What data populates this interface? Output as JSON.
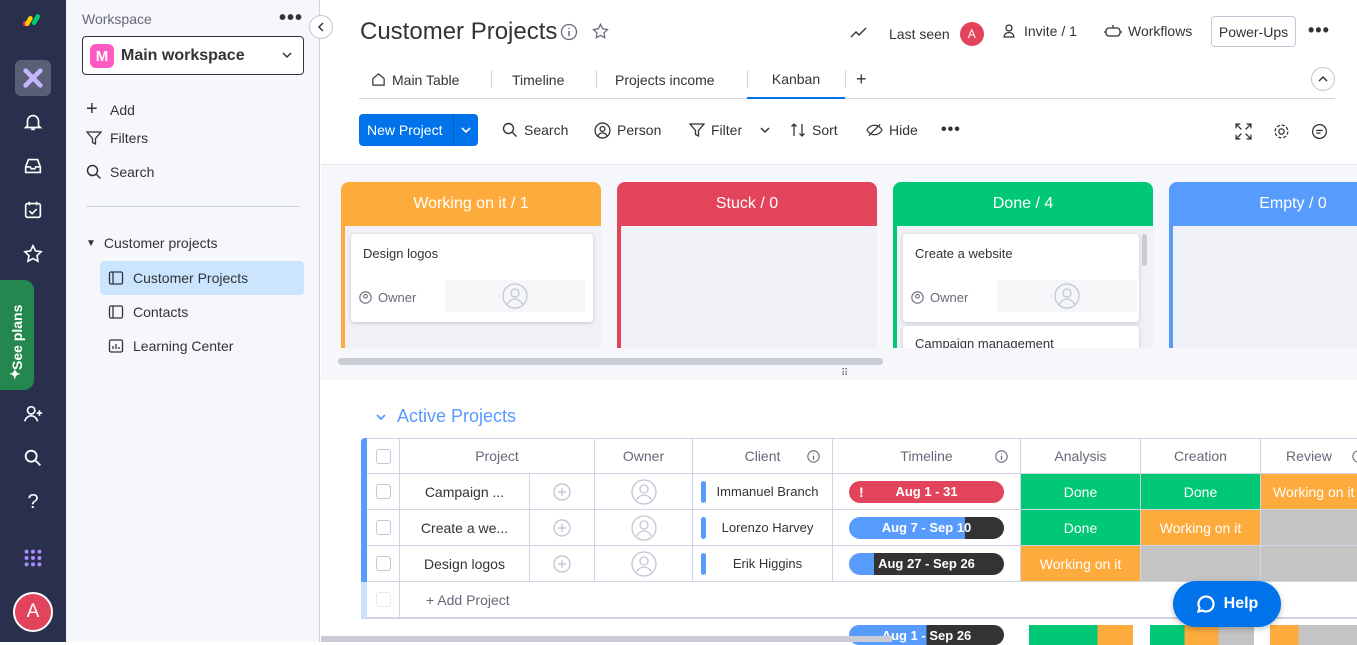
{
  "sidebar": {
    "see_plans": "See plans",
    "avatar_letter": "A",
    "icons": [
      "monday-logo",
      "home-icon",
      "bell-icon",
      "inbox-icon",
      "my-work-icon",
      "star-icon",
      "invite-members-icon",
      "search-icon",
      "help-icon",
      "apps-grid-icon"
    ]
  },
  "workspace": {
    "label": "Workspace",
    "selected": "Main workspace",
    "badge_letter": "M",
    "actions": [
      "Add",
      "Filters",
      "Search"
    ],
    "folder": "Customer projects",
    "items": [
      "Customer Projects",
      "Contacts",
      "Learning Center"
    ]
  },
  "header": {
    "title": "Customer Projects",
    "last_seen": "Last seen",
    "last_seen_avatar": "A",
    "invite": "Invite / 1",
    "workflows": "Workflows",
    "power_ups": "Power-Ups"
  },
  "tabs": [
    "Main Table",
    "Timeline",
    "Projects income",
    "Kanban"
  ],
  "add_tab": "+",
  "toolbar": {
    "new_project": "New Project",
    "search": "Search",
    "person": "Person",
    "filter": "Filter",
    "sort": "Sort",
    "hide": "Hide"
  },
  "kanban": {
    "columns": [
      {
        "label": "Working on it / 1",
        "color": "#fdab3d"
      },
      {
        "label": "Stuck / 0",
        "color": "#e2445c"
      },
      {
        "label": "Done / 4",
        "color": "#00c875"
      },
      {
        "label": "Empty / 0",
        "color": "#579bfc"
      }
    ],
    "cards": {
      "working": {
        "title": "Design logos",
        "owner": "Owner"
      },
      "done1": {
        "title": "Create a website",
        "owner": "Owner"
      },
      "done2": {
        "title": "Campaign management"
      }
    }
  },
  "group": {
    "title": "Active Projects",
    "headers": [
      "Project",
      "Owner",
      "Client",
      "Timeline",
      "Analysis",
      "Creation",
      "Review"
    ],
    "rows": [
      {
        "project": "Campaign ...",
        "client": "Immanuel Branch",
        "timeline": "Aug 1 - 31",
        "analysis": "Done",
        "creation": "Done",
        "review": "Working on it"
      },
      {
        "project": "Create a we...",
        "client": "Lorenzo Harvey",
        "timeline": "Aug 7 - Sep 10",
        "analysis": "Done",
        "creation": "Working on it",
        "review": ""
      },
      {
        "project": "Design logos",
        "client": "Erik Higgins",
        "timeline": "Aug 27 - Sep 26",
        "analysis": "Working on it",
        "creation": "",
        "review": ""
      }
    ],
    "add_row": "+ Add Project",
    "peek_timeline": "Aug 1 - Sep 26"
  },
  "help": "Help",
  "colors": {
    "done": "#00c875",
    "working": "#fdab3d",
    "stuck": "#e2445c",
    "empty": "#c4c4c4",
    "primary": "#0073ea"
  }
}
